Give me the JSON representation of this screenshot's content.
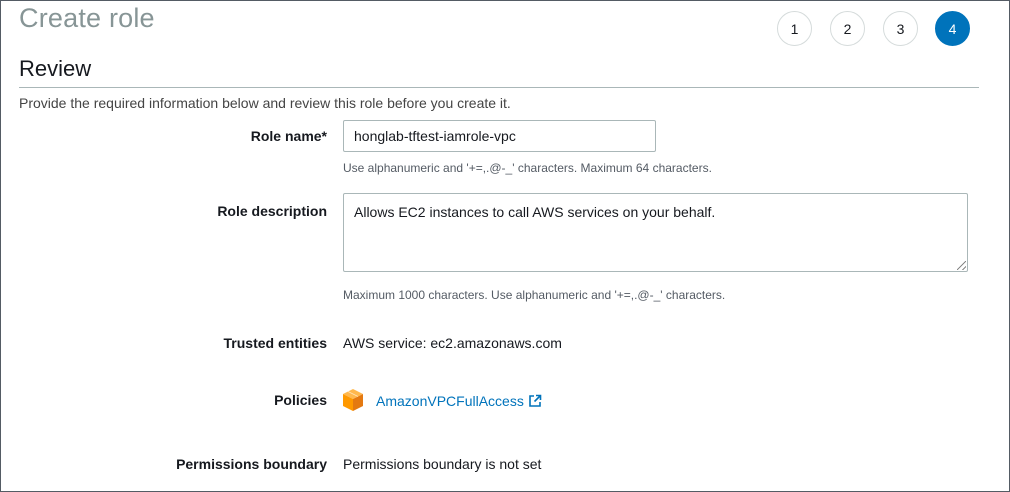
{
  "page": {
    "title": "Create role",
    "steps": [
      "1",
      "2",
      "3",
      "4"
    ],
    "active_step": "4"
  },
  "review": {
    "heading": "Review",
    "intro": "Provide the required information below and review this role before you create it."
  },
  "form": {
    "role_name": {
      "label": "Role name*",
      "value": "honglab-tftest-iamrole-vpc",
      "hint": "Use alphanumeric and '+=,.@-_' characters. Maximum 64 characters."
    },
    "role_description": {
      "label": "Role description",
      "value": "Allows EC2 instances to call AWS services on your behalf.",
      "hint": "Maximum 1000 characters. Use alphanumeric and '+=,.@-_' characters."
    },
    "trusted_entities": {
      "label": "Trusted entities",
      "value": "AWS service: ec2.amazonaws.com"
    },
    "policies": {
      "label": "Policies",
      "items": [
        {
          "name": "AmazonVPCFullAccess",
          "icon": "aws-policy-cube-icon",
          "link_icon": "external-link-icon"
        }
      ]
    },
    "permissions_boundary": {
      "label": "Permissions boundary",
      "value": "Permissions boundary is not set"
    }
  },
  "colors": {
    "accent": "#0073bb",
    "policy_icon": "#f90",
    "title_gray": "#879596"
  }
}
